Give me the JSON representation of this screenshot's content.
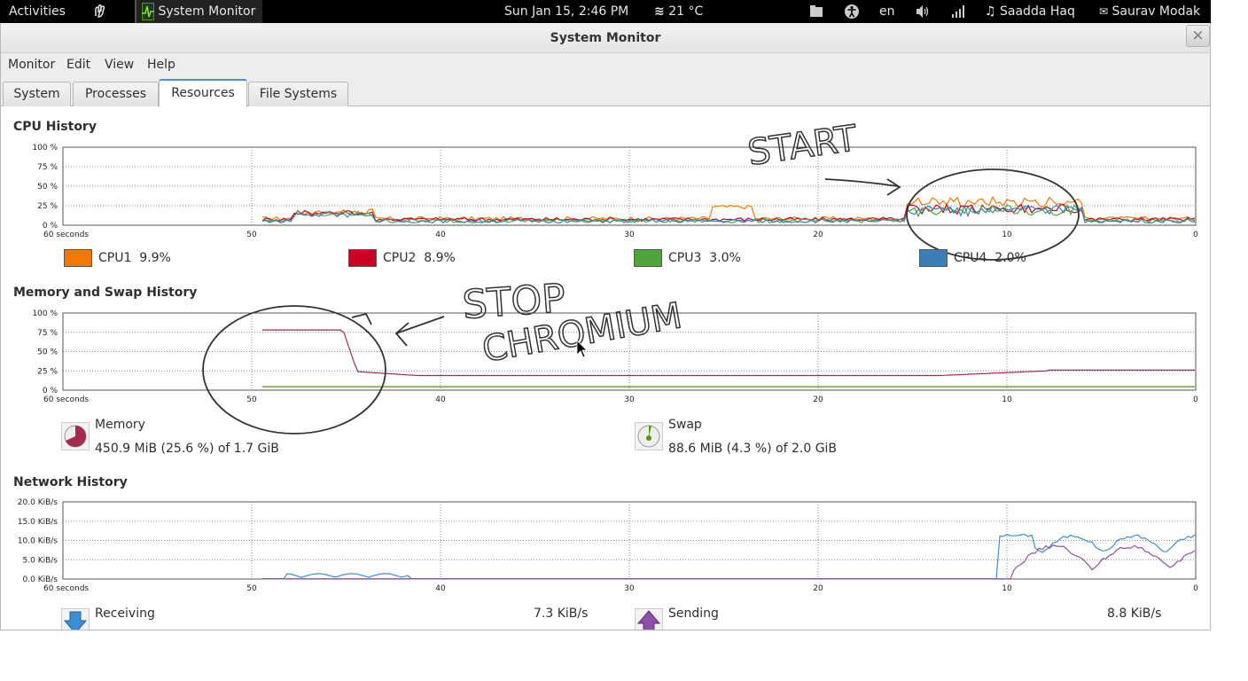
{
  "topbar": {
    "activities": "Activities",
    "app_name": "System Monitor",
    "datetime": "Sun Jan 15,  2:46 PM",
    "weather": "21 °C",
    "lang": "en",
    "music_user": "Saadda Haq",
    "user": "Saurav Modak"
  },
  "window": {
    "title": "System Monitor",
    "close_glyph": "×"
  },
  "menubar": [
    "Monitor",
    "Edit",
    "View",
    "Help"
  ],
  "tabs": [
    {
      "label": "System",
      "active": false
    },
    {
      "label": "Processes",
      "active": false
    },
    {
      "label": "Resources",
      "active": true
    },
    {
      "label": "File Systems",
      "active": false
    }
  ],
  "x_ticks": [
    "60 seconds",
    "50",
    "40",
    "30",
    "20",
    "10",
    "0"
  ],
  "cpu": {
    "title": "CPU History",
    "y_ticks": [
      "100 %",
      "75 %",
      "50 %",
      "25 %",
      "0 %"
    ],
    "legend": [
      {
        "label": "CPU1",
        "value": "9.9%",
        "color": "#f57900"
      },
      {
        "label": "CPU2",
        "value": "8.9%",
        "color": "#cc0022"
      },
      {
        "label": "CPU3",
        "value": "3.0%",
        "color": "#4ea63a"
      },
      {
        "label": "CPU4",
        "value": "2.0%",
        "color": "#3a7fb8"
      }
    ]
  },
  "memory": {
    "title": "Memory and Swap History",
    "y_ticks": [
      "100 %",
      "75 %",
      "50 %",
      "25 %",
      "0 %"
    ],
    "memory_label": "Memory",
    "memory_value": "450.9 MiB (25.6 %) of 1.7 GiB",
    "memory_color": "#a7294f",
    "swap_label": "Swap",
    "swap_value": "88.6 MiB (4.3 %) of 2.0 GiB",
    "swap_color": "#4e9a06"
  },
  "network": {
    "title": "Network History",
    "y_ticks": [
      "20.0 KiB/s",
      "15.0 KiB/s",
      "10.0 KiB/s",
      "5.0 KiB/s",
      "0.0 KiB/s"
    ],
    "receiving_label": "Receiving",
    "receiving_value": "7.3 KiB/s",
    "receiving_color": "#3a8fd6",
    "sending_label": "Sending",
    "sending_value": "8.8 KiB/s",
    "sending_color": "#8e4fa8"
  },
  "annotations": {
    "start": "START",
    "stop": "STOP",
    "chromium": "CHROMIUM"
  }
}
